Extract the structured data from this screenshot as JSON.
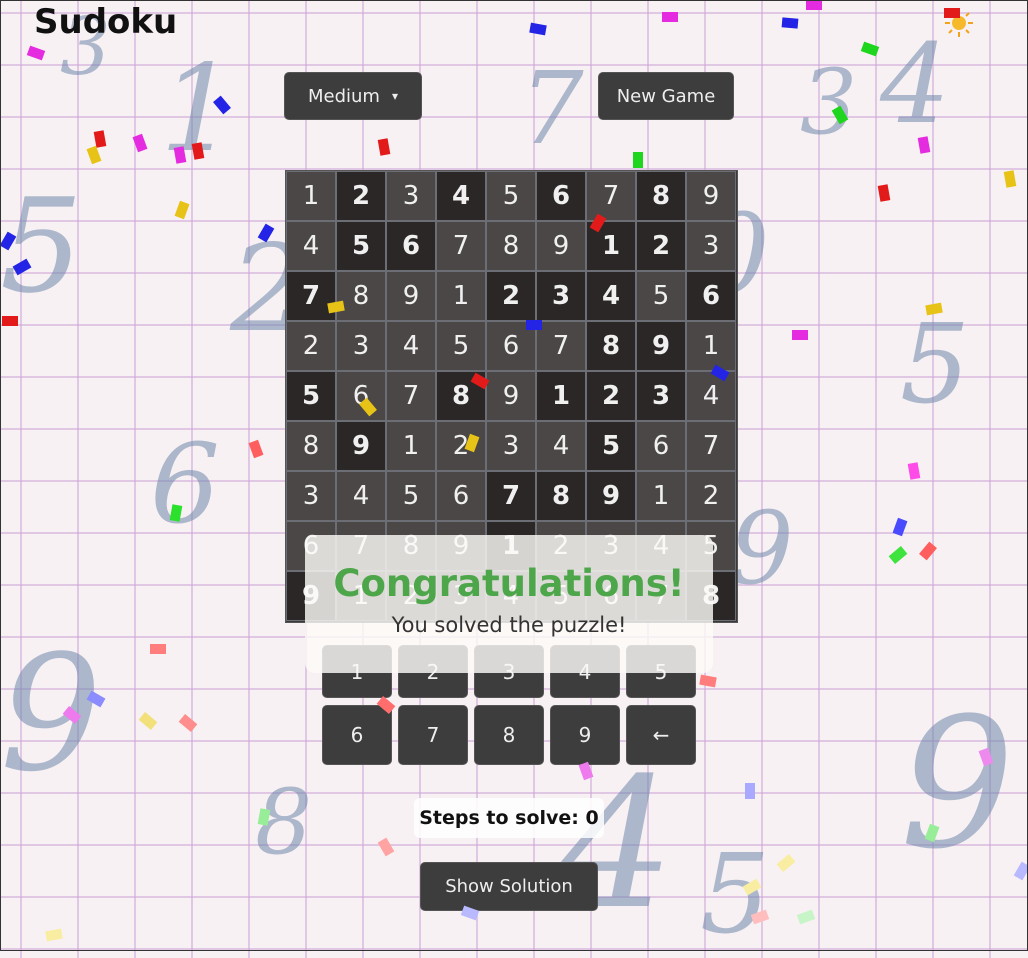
{
  "app": {
    "title": "Sudoku"
  },
  "controls": {
    "difficulty": "Medium",
    "new_game": "New Game",
    "show_solution": "Show Solution"
  },
  "board": {
    "cells": [
      [
        "1",
        "2",
        "3",
        "4",
        "5",
        "6",
        "7",
        "8",
        "9"
      ],
      [
        "4",
        "5",
        "6",
        "7",
        "8",
        "9",
        "1",
        "2",
        "3"
      ],
      [
        "7",
        "8",
        "9",
        "1",
        "2",
        "3",
        "4",
        "5",
        "6"
      ],
      [
        "2",
        "3",
        "4",
        "5",
        "6",
        "7",
        "8",
        "9",
        "1"
      ],
      [
        "5",
        "6",
        "7",
        "8",
        "9",
        "1",
        "2",
        "3",
        "4"
      ],
      [
        "8",
        "9",
        "1",
        "2",
        "3",
        "4",
        "5",
        "6",
        "7"
      ],
      [
        "3",
        "4",
        "5",
        "6",
        "7",
        "8",
        "9",
        "1",
        "2"
      ],
      [
        "6",
        "7",
        "8",
        "9",
        "1",
        "2",
        "3",
        "4",
        "5"
      ],
      [
        "9",
        "1",
        "2",
        "3",
        "4",
        "5",
        "6",
        "7",
        "8"
      ]
    ],
    "given": [
      [
        0,
        1,
        0,
        1,
        0,
        1,
        0,
        1,
        0
      ],
      [
        0,
        1,
        1,
        0,
        0,
        0,
        1,
        1,
        0
      ],
      [
        1,
        0,
        0,
        0,
        1,
        1,
        1,
        0,
        1
      ],
      [
        0,
        0,
        0,
        0,
        0,
        0,
        1,
        1,
        0
      ],
      [
        1,
        0,
        0,
        1,
        0,
        1,
        1,
        1,
        0
      ],
      [
        0,
        1,
        0,
        0,
        0,
        0,
        1,
        0,
        0
      ],
      [
        0,
        0,
        0,
        0,
        1,
        1,
        1,
        0,
        0
      ],
      [
        0,
        0,
        0,
        0,
        1,
        0,
        0,
        0,
        0
      ],
      [
        1,
        0,
        0,
        0,
        0,
        0,
        0,
        0,
        1
      ]
    ]
  },
  "numpad": {
    "keys": [
      "1",
      "2",
      "3",
      "4",
      "5",
      "6",
      "7",
      "8",
      "9",
      "←"
    ]
  },
  "overlay": {
    "title": "Congratulations!",
    "message": "You solved the puzzle!"
  },
  "status": {
    "steps": "Steps to solve: 0"
  },
  "colors": {
    "button_bg": "#3d3d3d",
    "given_cell": "#2b2726",
    "cell": "#4b4746",
    "success": "#4ea64b"
  }
}
